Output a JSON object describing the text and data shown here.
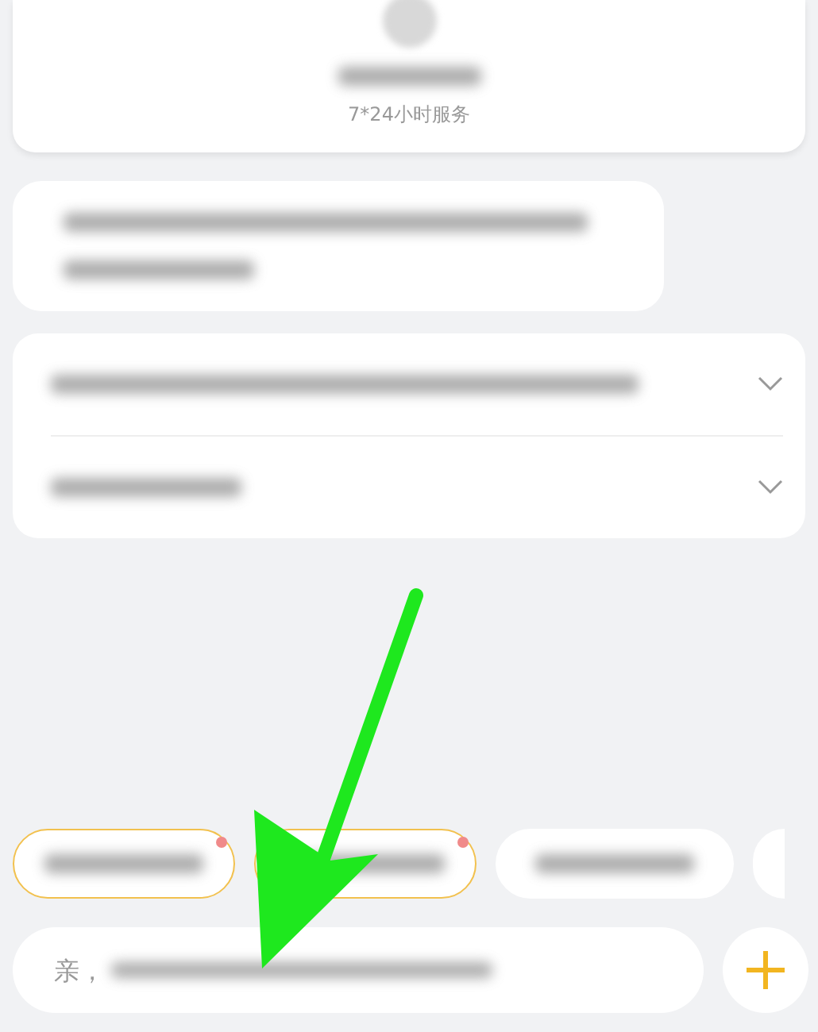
{
  "service_card": {
    "subtitle": "7*24小时服务"
  },
  "accordion": {
    "items": [
      {
        "expanded": false
      },
      {
        "expanded": false
      }
    ]
  },
  "chips": [
    {
      "highlighted": true,
      "dot": true
    },
    {
      "highlighted": true,
      "dot": true
    },
    {
      "highlighted": false,
      "dot": false
    }
  ],
  "input": {
    "placeholder": "亲，"
  }
}
